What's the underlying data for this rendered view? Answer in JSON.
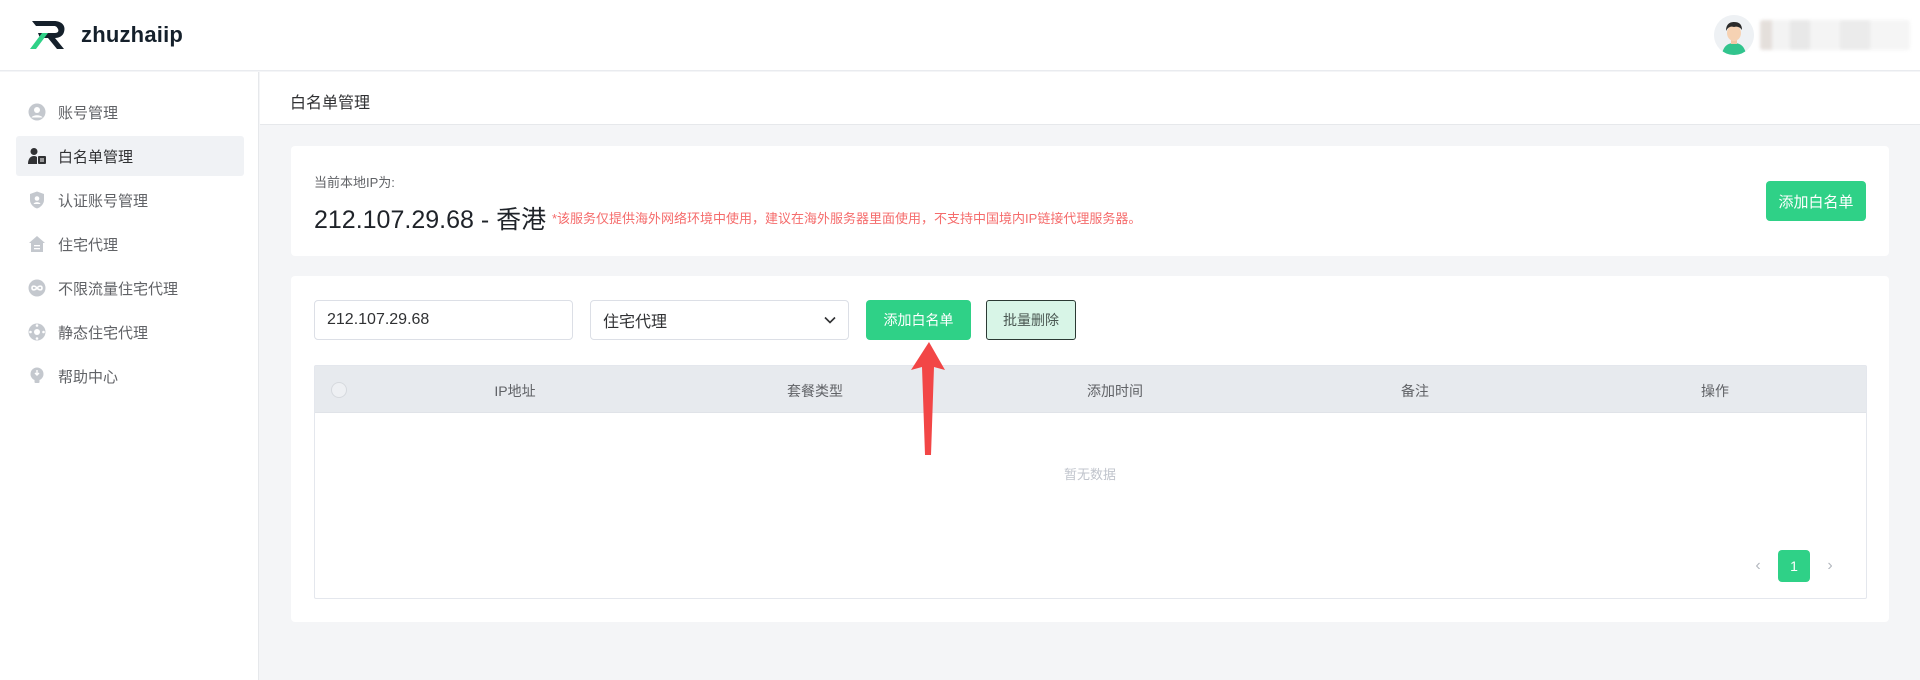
{
  "header": {
    "logo_text": "zhuzhaiip"
  },
  "sidebar": {
    "items": [
      {
        "label": "账号管理",
        "icon": "user-circle-icon"
      },
      {
        "label": "白名单管理",
        "icon": "user-card-icon",
        "active": true
      },
      {
        "label": "认证账号管理",
        "icon": "shield-user-icon"
      },
      {
        "label": "住宅代理",
        "icon": "house-icon"
      },
      {
        "label": "不限流量住宅代理",
        "icon": "infinity-icon"
      },
      {
        "label": "静态住宅代理",
        "icon": "globe-icon"
      },
      {
        "label": "帮助中心",
        "icon": "lightbulb-icon"
      }
    ]
  },
  "breadcrumb": "白名单管理",
  "local_ip": {
    "caption": "当前本地IP为:",
    "value": "212.107.29.68 - 香港",
    "notice": "*该服务仅提供海外网络环境中使用，建议在海外服务器里面使用，不支持中国境内IP链接代理服务器。",
    "add_button": "添加白名单"
  },
  "form": {
    "ip_value": "212.107.29.68",
    "type_selected": "住宅代理",
    "add_button": "添加白名单",
    "batch_delete_button": "批量删除"
  },
  "table": {
    "columns": [
      "IP地址",
      "套餐类型",
      "添加时间",
      "备注",
      "操作"
    ],
    "empty_text": "暂无数据"
  },
  "pagination": {
    "current_page": "1",
    "prev": "‹",
    "next": "›"
  },
  "colors": {
    "accent": "#2fd187",
    "notice": "#f56c6c",
    "annotation_arrow": "#f24646"
  }
}
